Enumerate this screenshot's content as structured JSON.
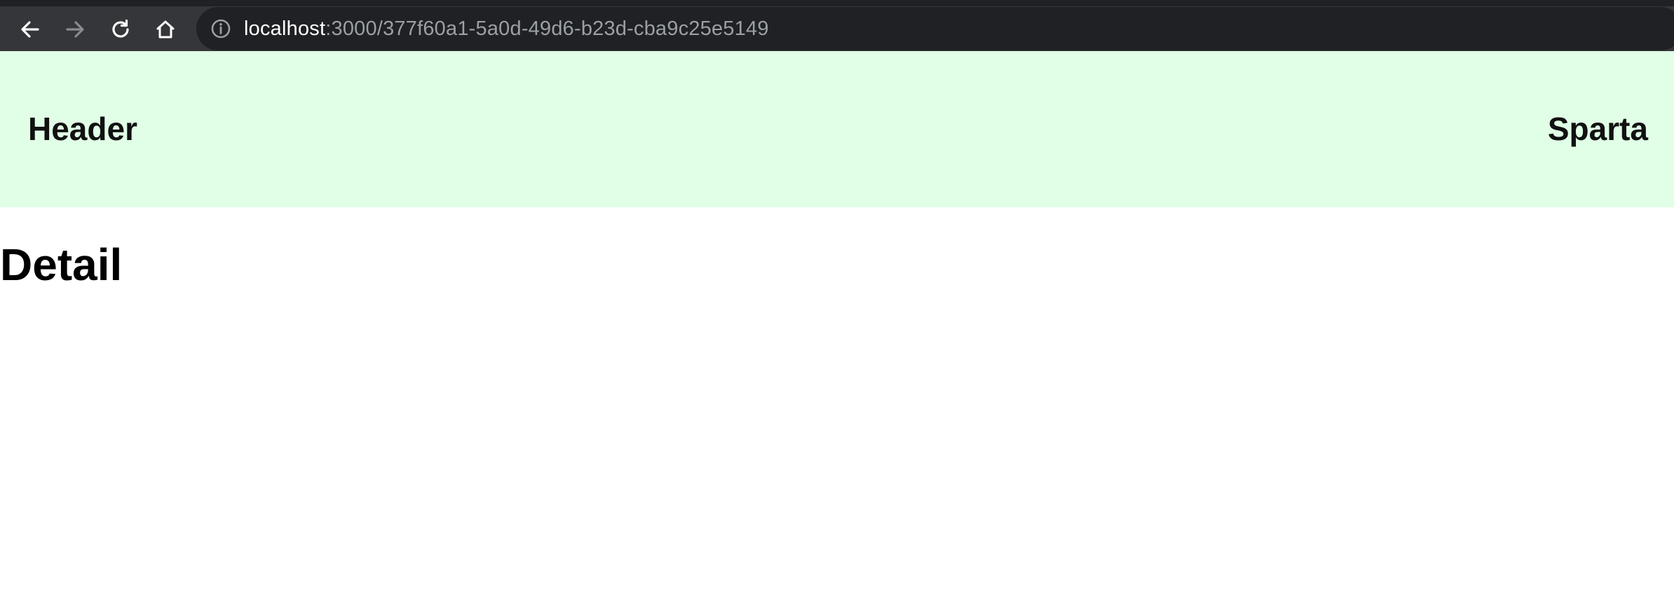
{
  "browser": {
    "url_host": "localhost",
    "url_rest": ":3000/377f60a1-5a0d-49d6-b23d-cba9c25e5149",
    "icons": [
      "back-arrow-icon",
      "forward-arrow-icon",
      "reload-icon",
      "home-icon",
      "info-icon"
    ]
  },
  "header": {
    "title": "Header",
    "brand": "Sparta",
    "background": "#e0ffe6"
  },
  "main": {
    "heading": "Detail"
  }
}
